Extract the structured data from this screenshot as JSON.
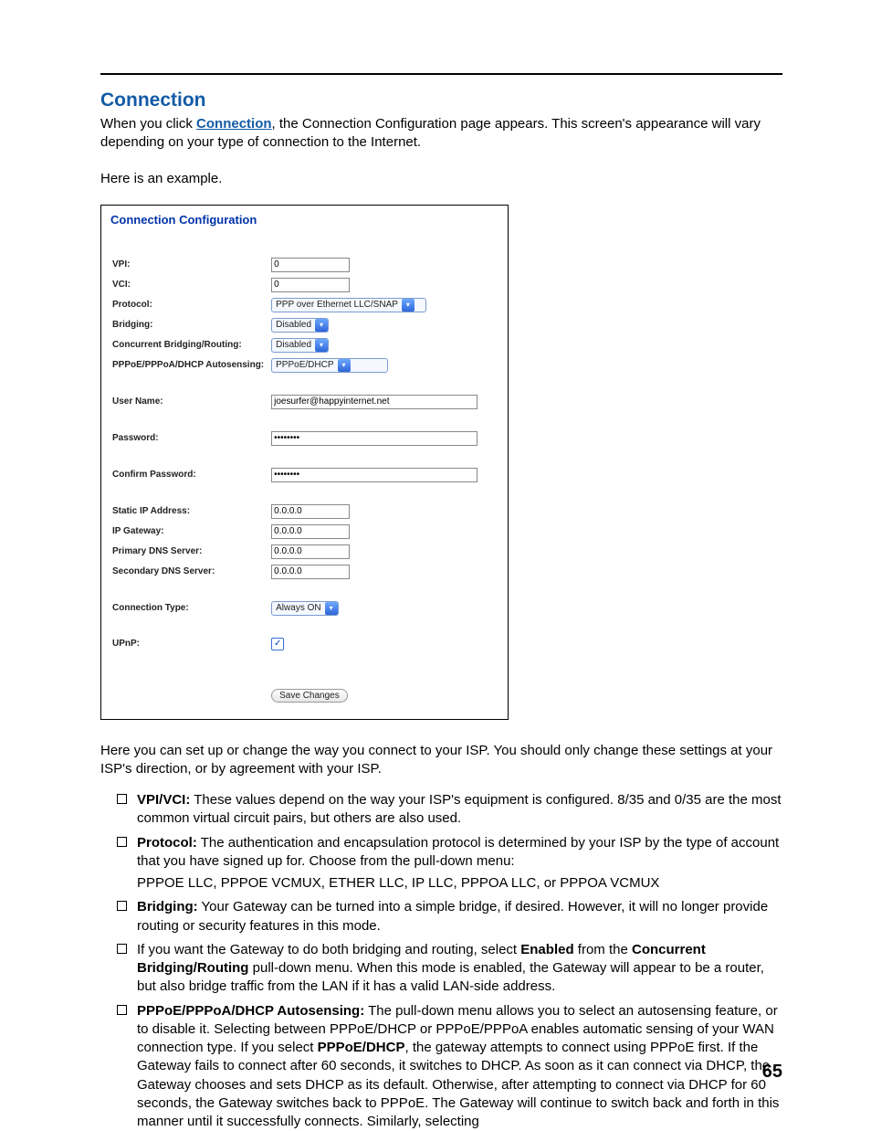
{
  "section_title": "Connection",
  "intro_pre": "When you click ",
  "intro_link": "Connection",
  "intro_post": ", the Connection Configuration page appears. This screen's appearance will vary depending on your type of connection to the Internet.",
  "example_label": "Here is an example.",
  "panel_title": "Connection Configuration",
  "form": {
    "vpi": {
      "label": "VPI:",
      "value": "0"
    },
    "vci": {
      "label": "VCI:",
      "value": "0"
    },
    "protocol": {
      "label": "Protocol:",
      "value": "PPP over Ethernet LLC/SNAP"
    },
    "bridging": {
      "label": "Bridging:",
      "value": "Disabled"
    },
    "concurrent": {
      "label": "Concurrent Bridging/Routing:",
      "value": "Disabled"
    },
    "autosense": {
      "label": "PPPoE/PPPoA/DHCP Autosensing:",
      "value": "PPPoE/DHCP"
    },
    "username": {
      "label": "User Name:",
      "value": "joesurfer@happyinternet.net"
    },
    "password": {
      "label": "Password:",
      "value": "••••••••"
    },
    "confirm": {
      "label": "Confirm Password:",
      "value": "••••••••"
    },
    "static_ip": {
      "label": "Static IP Address:",
      "value": "0.0.0.0"
    },
    "gateway": {
      "label": "IP Gateway:",
      "value": "0.0.0.0"
    },
    "dns1": {
      "label": "Primary DNS Server:",
      "value": "0.0.0.0"
    },
    "dns2": {
      "label": "Secondary DNS Server:",
      "value": "0.0.0.0"
    },
    "conn_type": {
      "label": "Connection Type:",
      "value": "Always ON"
    },
    "upnp": {
      "label": "UPnP:",
      "checked": true
    },
    "save_btn": "Save Changes"
  },
  "post_panel": "Here you can set up or change the way you connect to your ISP. You should only change these settings at your ISP's direction, or by agreement with your ISP.",
  "bullets": {
    "b1_label": "VPI/VCI:",
    "b1_text": " These values depend on the way your ISP's equipment is configured. 8/35 and 0/35 are the most common virtual circuit pairs, but others are also used.",
    "b2_label": "Protocol:",
    "b2_text": " The authentication and encapsulation protocol is determined by your ISP by the type of account that you have signed up for. Choose from the pull-down menu:",
    "b2_sub": "PPPOE LLC, PPPOE VCMUX, ETHER LLC, IP LLC, PPPOA LLC, or PPPOA VCMUX",
    "b3_label": "Bridging:",
    "b3_text": " Your Gateway can be turned into a simple bridge, if desired. However, it will no longer provide routing or security features in this mode.",
    "b4_pre": "If you want the Gateway to do both bridging and routing, select ",
    "b4_enabled": "Enabled",
    "b4_mid": " from the ",
    "b4_cbr": "Concurrent Bridging/Routing",
    "b4_post": " pull-down menu. When this mode is enabled, the Gateway will appear to be a router, but also bridge traffic from the LAN if it has a valid LAN-side address.",
    "b5_label": "PPPoE/PPPoA/DHCP Autosensing:",
    "b5_text1": " The pull-down menu allows you to select an autosensing feature, or to disable it. Selecting between PPPoE/DHCP or PPPoE/PPPoA enables automatic sensing of your WAN connection type. If you select ",
    "b5_bold": "PPPoE/DHCP",
    "b5_text2": ", the gateway attempts to connect using PPPoE first. If the Gateway fails to connect after 60 seconds, it switches to DHCP. As soon as it can connect via DHCP, the Gateway chooses and sets DHCP as its default. Otherwise, after attempting to connect via DHCP for 60 seconds, the Gateway switches back to PPPoE. The Gateway will continue to switch back and forth in this manner until it successfully connects. Similarly, selecting"
  },
  "page_number": "65"
}
